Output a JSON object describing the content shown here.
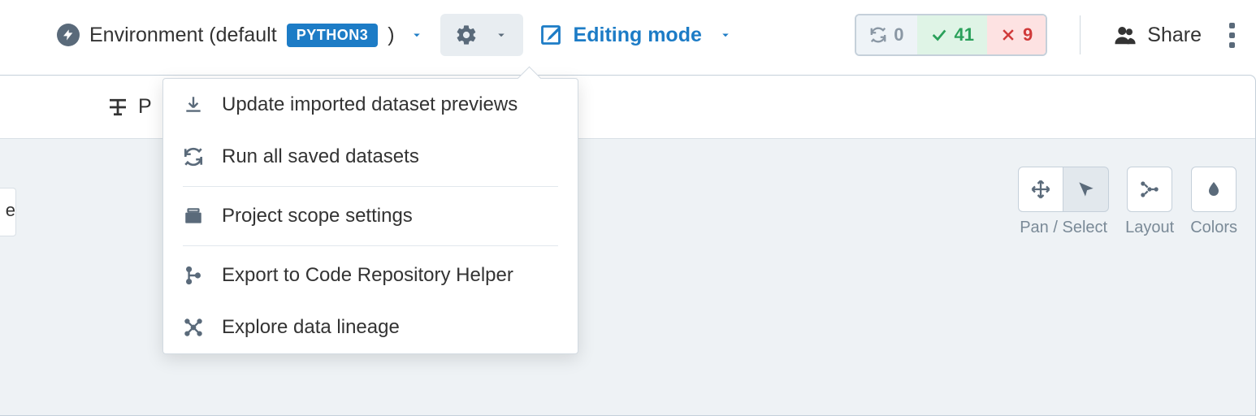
{
  "toolbar": {
    "environment_prefix": "Environment (default",
    "language_badge": "PYTHON3",
    "environment_suffix": ")",
    "editing_label": "Editing mode"
  },
  "status": {
    "refresh_count": "0",
    "pass_count": "41",
    "fail_count": "9"
  },
  "share": {
    "label": "Share"
  },
  "tabbar": {
    "peek_label": "P",
    "left_peek": "e"
  },
  "right_controls": {
    "pan_select_label": "Pan / Select",
    "layout_label": "Layout",
    "colors_label": "Colors"
  },
  "dropdown": {
    "items": [
      "Update imported dataset previews",
      "Run all saved datasets",
      "Project scope settings",
      "Export to Code Repository Helper",
      "Explore data lineage"
    ]
  }
}
